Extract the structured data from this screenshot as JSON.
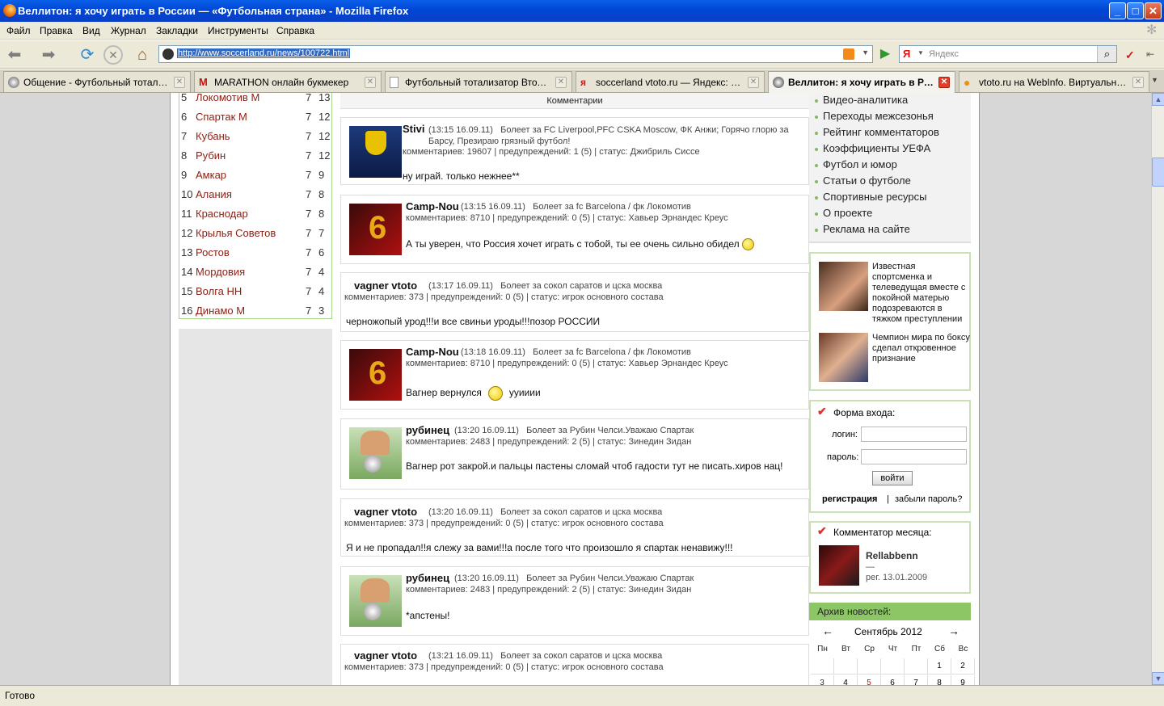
{
  "window": {
    "title": "Веллитон: я хочу играть в России — «Футбольная страна» - Mozilla Firefox"
  },
  "menu": [
    "Файл",
    "Правка",
    "Вид",
    "Журнал",
    "Закладки",
    "Инструменты",
    "Справка"
  ],
  "nav": {
    "url": "http://www.soccerland.ru/news/100722.html",
    "search_placeholder": "Яндекс",
    "search_engine": "Я"
  },
  "tabs": [
    {
      "label": "Общение - Футбольный тотализ...",
      "icon": "soccer-ball-icon"
    },
    {
      "label": "MARATHON онлайн букмекер",
      "icon": "marathon-icon"
    },
    {
      "label": "Футбольный тотализатор Втото....",
      "icon": "page-icon"
    },
    {
      "label": "soccerland vtoto.ru — Яндекс: на...",
      "icon": "yandex-icon"
    },
    {
      "label": "Веллитон: я хочу играть в Ро...",
      "icon": "soccer-ball-icon"
    },
    {
      "label": "vtoto.ru на WebInfo. Виртуальны...",
      "icon": "bulb-icon"
    }
  ],
  "standings": [
    {
      "pos": "5",
      "team": "Локомотив М",
      "games": "7",
      "points": "13"
    },
    {
      "pos": "6",
      "team": "Спартак М",
      "games": "7",
      "points": "12"
    },
    {
      "pos": "7",
      "team": "Кубань",
      "games": "7",
      "points": "12"
    },
    {
      "pos": "8",
      "team": "Рубин",
      "games": "7",
      "points": "12"
    },
    {
      "pos": "9",
      "team": "Амкар",
      "games": "7",
      "points": "9"
    },
    {
      "pos": "10",
      "team": "Алания",
      "games": "7",
      "points": "8"
    },
    {
      "pos": "11",
      "team": "Краснодар",
      "games": "7",
      "points": "8"
    },
    {
      "pos": "12",
      "team": "Крылья Советов",
      "games": "7",
      "points": "7"
    },
    {
      "pos": "13",
      "team": "Ростов",
      "games": "7",
      "points": "6"
    },
    {
      "pos": "14",
      "team": "Мордовия",
      "games": "7",
      "points": "4"
    },
    {
      "pos": "15",
      "team": "Волга НН",
      "games": "7",
      "points": "4"
    },
    {
      "pos": "16",
      "team": "Динамо М",
      "games": "7",
      "points": "3"
    }
  ],
  "comments_header": "Комментарии",
  "comments": [
    {
      "name": "Stivi",
      "time": "(13:15 16.09.11)",
      "fan": "Болеет за FC Liverpool,PFC CSKA Moscow, ФК Анжи; Горячо глорю за Барсу, Презираю грязный футбол!",
      "stats": "комментариев: 19607  |  предупреждений: 1 (5)  |  статус: Джибриль Сиссе",
      "text": "ну играй. только нежнее**",
      "avatar": "anzhi-logo"
    },
    {
      "name": "Camp-Nou",
      "time": "(13:15 16.09.11)",
      "fan": "Болеет за fc Barcelona / фк Локомотив",
      "stats": "комментариев: 8710  |  предупреждений: 0 (5)  |  статус: Хавьер Эрнандес Креус",
      "text": "А ты уверен, что Россия хочет играть с тобой, ты ее очень сильно обидел",
      "avatar": "xavi-6"
    },
    {
      "name": "vagner vtoto",
      "time": "(13:17 16.09.11)",
      "fan": "Болеет за сокол саратов и цска москва",
      "stats": "комментариев: 373  |  предупреждений: 0 (5)  |  статус: игрок основного состава",
      "text": "черножопый урод!!!и все свиньи уроды!!!позор РОССИИ",
      "avatar": ""
    },
    {
      "name": "Camp-Nou",
      "time": "(13:18 16.09.11)",
      "fan": "Болеет за fc Barcelona / фк Локомотив",
      "stats": "комментариев: 8710  |  предупреждений: 0 (5)  |  статус: Хавьер Эрнандес Креус",
      "text": "Вагнер вернулся",
      "text_after": "ууииии",
      "avatar": "xavi-6"
    },
    {
      "name": "рубинец",
      "time": "(13:20 16.09.11)",
      "fan": "Болеет за Рубин Челси.Уважаю Спартак",
      "stats": "комментариев: 2483  |  предупреждений: 2 (5)  |  статус: Зинедин Зидан",
      "text": "Вагнер рот закрой.и пальцы пастены сломай чтоб гадости тут не писать.хиров нац!",
      "avatar": "ball-foot"
    },
    {
      "name": "vagner vtoto",
      "time": "(13:20 16.09.11)",
      "fan": "Болеет за сокол саратов и цска москва",
      "stats": "комментариев: 373  |  предупреждений: 0 (5)  |  статус: игрок основного состава",
      "text": "Я и не пропадал!!я слежу за вами!!!а после того что произошло я спартак ненавижу!!!",
      "avatar": ""
    },
    {
      "name": "рубинец",
      "time": "(13:20 16.09.11)",
      "fan": "Болеет за Рубин Челси.Уважаю Спартак",
      "stats": "комментариев: 2483  |  предупреждений: 2 (5)  |  статус: Зинедин Зидан",
      "text": "*апстены!",
      "avatar": "ball-foot"
    },
    {
      "name": "vagner vtoto",
      "time": "(13:21 16.09.11)",
      "fan": "Болеет за сокол саратов и цска москва",
      "stats": "комментариев: 373  |  предупреждений: 0 (5)  |  статус: игрок основного состава",
      "text": "",
      "avatar": ""
    }
  ],
  "right_menu": [
    "Видео-аналитика",
    "Переходы межсезонья",
    "Рейтинг комментаторов",
    "Коэффициенты УЕФА",
    "Футбол и юмор",
    "Статьи о футболе",
    "Спортивные ресурсы",
    "О проекте",
    "Реклама на сайте"
  ],
  "news": [
    {
      "text": "Известная спортсменка и телеведущая вместе с покойной матерью подозреваются в тяжком преступлении"
    },
    {
      "text": "Чемпион мира по боксу сделал откровенное признание"
    }
  ],
  "login": {
    "title": "Форма входа:",
    "login_label": "логин:",
    "password_label": "пароль:",
    "submit": "войти",
    "register": "регистрация",
    "separator": "|",
    "forgot": "забыли пароль?"
  },
  "commentator": {
    "title": "Комментатор месяца:",
    "name": "Rellabbenn",
    "dash": "—",
    "reg": "рег. 13.01.2009"
  },
  "archive": {
    "title": "Архив новостей:",
    "month": "Сентябрь 2012",
    "prev": "←",
    "next": "→",
    "days": [
      "Пн",
      "Вт",
      "Ср",
      "Чт",
      "Пт",
      "Сб",
      "Вс"
    ],
    "row1": [
      "",
      "",
      "",
      "",
      "",
      "1",
      "2"
    ],
    "row2": [
      "3",
      "4",
      "5",
      "6",
      "7",
      "8",
      "9"
    ]
  },
  "status": "Готово",
  "colors": {
    "team_link": "#8b1e12",
    "box_border": "#c8e2b6",
    "archive_header": "#8cc665"
  }
}
